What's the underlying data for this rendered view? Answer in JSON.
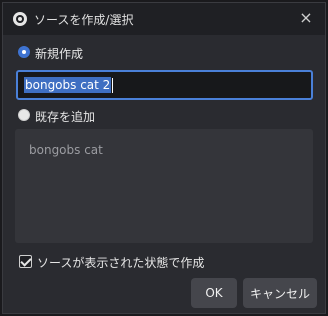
{
  "window": {
    "title": "ソースを作成/選択",
    "close_icon": "×"
  },
  "create_new": {
    "label": "新規作成",
    "selected": true,
    "name_value": "bongobs cat 2"
  },
  "add_existing": {
    "label": "既存を追加",
    "selected": false,
    "items": [
      "bongobs cat"
    ]
  },
  "visible_checkbox": {
    "label": "ソースが表示された状態で作成",
    "checked": true
  },
  "buttons": {
    "ok": "OK",
    "cancel": "キャンセル"
  },
  "colors": {
    "accent": "#3e73d1",
    "dialog_bg": "#2a2b30",
    "titlebar_bg": "#1f2024"
  }
}
